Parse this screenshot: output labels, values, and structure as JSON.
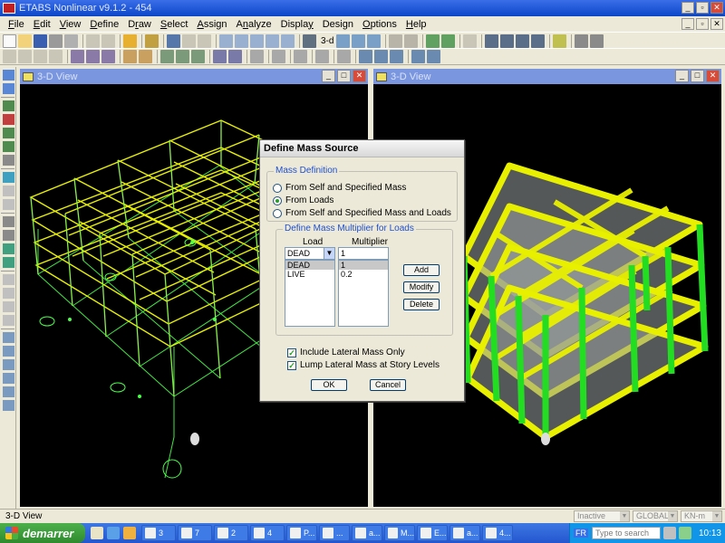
{
  "app": {
    "title": "ETABS Nonlinear v9.1.2 - 454"
  },
  "menu": [
    {
      "label": "File",
      "ul": "F"
    },
    {
      "label": "Edit",
      "ul": "E"
    },
    {
      "label": "View",
      "ul": "V"
    },
    {
      "label": "Define",
      "ul": "D"
    },
    {
      "label": "Draw",
      "ul": "r"
    },
    {
      "label": "Select",
      "ul": "S"
    },
    {
      "label": "Assign",
      "ul": "A"
    },
    {
      "label": "Analyze",
      "ul": "n"
    },
    {
      "label": "Display",
      "ul": "y"
    },
    {
      "label": "Design",
      "ul": "g"
    },
    {
      "label": "Options",
      "ul": "O"
    },
    {
      "label": "Help",
      "ul": "H"
    }
  ],
  "toolbar": {
    "view_3d_label": "3-d"
  },
  "views": [
    {
      "title": "3-D View"
    },
    {
      "title": "3-D View"
    }
  ],
  "dialog": {
    "title": "Define Mass Source",
    "mass_definition": {
      "legend": "Mass Definition",
      "options": [
        {
          "label": "From Self and Specified Mass",
          "selected": false
        },
        {
          "label": "From Loads",
          "selected": true
        },
        {
          "label": "From Self and Specified Mass and Loads",
          "selected": false
        }
      ]
    },
    "multiplier_group": {
      "legend": "Define Mass Multiplier for Loads",
      "load_header": "Load",
      "multiplier_header": "Multiplier",
      "load_value": "DEAD",
      "multiplier_value": "1",
      "rows": [
        {
          "load": "DEAD",
          "multiplier": "1"
        },
        {
          "load": "LIVE",
          "multiplier": "0.2"
        }
      ],
      "buttons": {
        "add": "Add",
        "modify": "Modify",
        "delete": "Delete"
      }
    },
    "checks": [
      {
        "label": "Include Lateral Mass Only",
        "checked": true
      },
      {
        "label": "Lump Lateral Mass at Story Levels",
        "checked": true
      }
    ],
    "ok": "OK",
    "cancel": "Cancel"
  },
  "status": {
    "text": "3-D View",
    "state": "Inactive",
    "coord": "GLOBAL",
    "units": "KN-m"
  },
  "taskbar": {
    "start": "demarrer",
    "tasks": [
      {
        "label": "3",
        "icon": "folder-icon"
      },
      {
        "label": "7",
        "icon": "acrobat-icon"
      },
      {
        "label": "2",
        "icon": "word-icon"
      },
      {
        "label": "4",
        "icon": "ie-icon"
      },
      {
        "label": "P...",
        "icon": "paint-icon"
      },
      {
        "label": "...",
        "icon": "notepad-icon"
      },
      {
        "label": "a...",
        "icon": "app-icon"
      },
      {
        "label": "M...",
        "icon": "excel-icon"
      },
      {
        "label": "E...",
        "icon": "etabs-icon"
      },
      {
        "label": "a...",
        "icon": "app-icon"
      },
      {
        "label": "4...",
        "icon": "app-icon"
      }
    ],
    "lang": "FR",
    "search_placeholder": "Type to search",
    "clock": "10:13"
  },
  "colors": {
    "wire_yellow": "#e8f000",
    "wire_green": "#4aff4a",
    "slab_gray": "#9aa0a0",
    "column_green": "#22dd22"
  }
}
